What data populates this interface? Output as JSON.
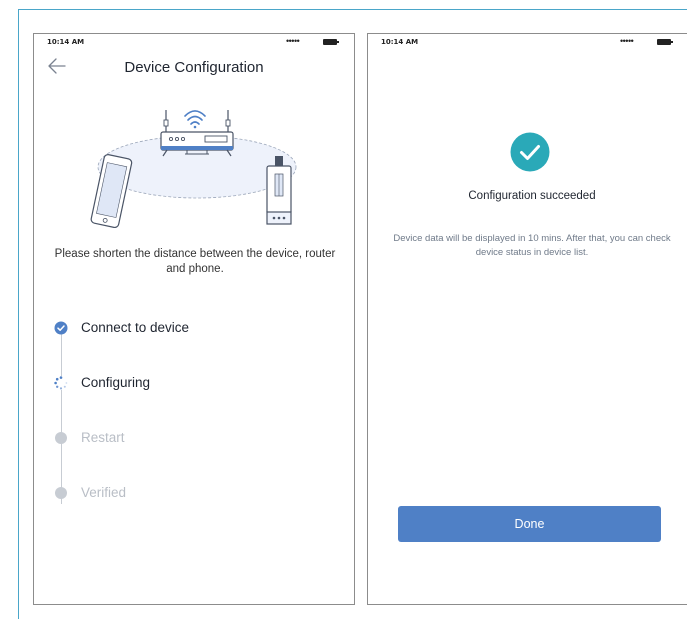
{
  "colors": {
    "accent": "#4f80c6",
    "success": "#2aa9b8",
    "pending": "#c7ccd3",
    "frame": "#4aa6c9"
  },
  "left_screen": {
    "status_time": "10:14 AM",
    "status_signal": "•••••",
    "title": "Device Configuration",
    "back_icon": "back-arrow-icon",
    "hint": "Please shorten the distance between the device, router and phone.",
    "steps": [
      {
        "label": "Connect to device",
        "state": "done",
        "icon": "check-circle-icon"
      },
      {
        "label": "Configuring",
        "state": "active",
        "icon": "spinner-icon"
      },
      {
        "label": "Restart",
        "state": "pending",
        "icon": "dot-icon"
      },
      {
        "label": "Verified",
        "state": "pending",
        "icon": "dot-icon"
      }
    ]
  },
  "right_screen": {
    "status_time": "10:14 AM",
    "status_signal": "•••••",
    "success_icon": "check-circle-icon",
    "title": "Configuration succeeded",
    "description": "Device data will be displayed in 10 mins. After that, you can check device status in device list.",
    "done_label": "Done"
  }
}
